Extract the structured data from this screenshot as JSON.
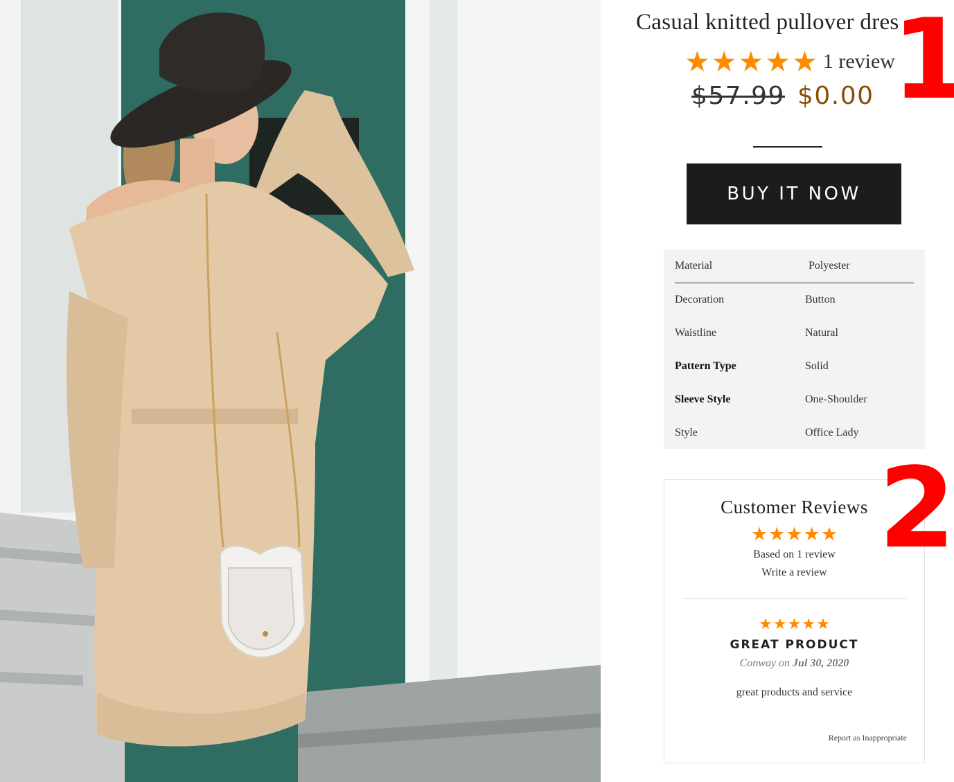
{
  "product": {
    "title": "Casual knitted pullover dres",
    "rating_stars": 5,
    "review_count_text": "1 review",
    "price_original": "$57.99",
    "price_sale": "$0.00",
    "buy_button_label": "BUY IT NOW"
  },
  "specs": [
    {
      "key": "Material",
      "value": "Polyester",
      "bold": false
    },
    {
      "key": "Decoration",
      "value": "Button",
      "bold": false
    },
    {
      "key": "Waistline",
      "value": "Natural",
      "bold": false
    },
    {
      "key": "Pattern Type",
      "value": "Solid",
      "bold": true
    },
    {
      "key": "Sleeve Style",
      "value": "One-Shoulder",
      "bold": true
    },
    {
      "key": "Style",
      "value": "Office Lady",
      "bold": false
    }
  ],
  "reviews": {
    "heading": "Customer Reviews",
    "summary_stars": 5,
    "based_on": "Based on 1 review",
    "write_link": "Write a review",
    "items": [
      {
        "stars": 5,
        "title": "GREAT PRODUCT",
        "author": "Conway",
        "on_word": "on",
        "date": "Jul 30, 2020",
        "body": "great products and service",
        "report": "Report as Inappropriate"
      }
    ]
  },
  "annotations": {
    "one": "1",
    "two": "2"
  },
  "colors": {
    "star": "#ff8a00",
    "sale_price": "#8a4e07",
    "button_bg": "#1c1c1e",
    "annotation": "#ff0000",
    "dress": "#e3c9a6",
    "teal_wall": "#2f6d63"
  },
  "icons": {
    "star": "star-icon"
  }
}
